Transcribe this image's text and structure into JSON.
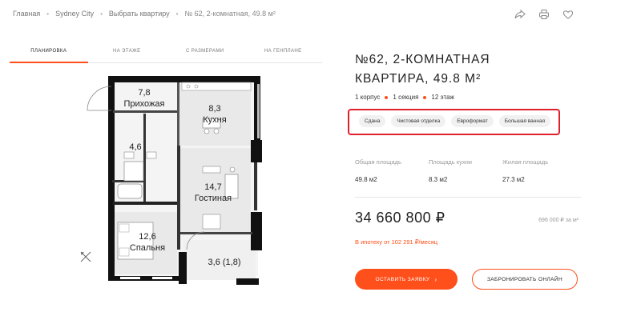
{
  "breadcrumb": {
    "items": [
      "Главная",
      "Sydney City",
      "Выбрать квартиру",
      "№ 62, 2-комнатная, 49.8 м²"
    ]
  },
  "toolbar": {
    "icons": [
      "share-icon",
      "print-icon",
      "heart-icon"
    ]
  },
  "tabs": [
    {
      "label": "ПЛАНИРОВКА",
      "active": true
    },
    {
      "label": "НА ЭТАЖЕ",
      "active": false
    },
    {
      "label": "С РАЗМЕРАМИ",
      "active": false
    },
    {
      "label": "НА ГЕНПЛАНЕ",
      "active": false
    }
  ],
  "floorplan": {
    "rooms": [
      {
        "area": "7,8",
        "name": "Прихожая"
      },
      {
        "area": "8,3",
        "name": "Кухня"
      },
      {
        "area": "4,6",
        "name": ""
      },
      {
        "area": "14,7",
        "name": "Гостиная"
      },
      {
        "area": "12,6",
        "name": "Спальня"
      },
      {
        "area": "3,6 (1,8)",
        "name": ""
      }
    ]
  },
  "apartment": {
    "title_line1": "№62, 2-КОМНАТНАЯ",
    "title_line2": "КВАРТИРА, 49.8 М²",
    "meta": [
      "1 корпус",
      "1 секция",
      "12 этаж"
    ],
    "tags": [
      "Сдана",
      "Чистовая отделка",
      "Евроформат",
      "Большая ванная"
    ]
  },
  "stats": [
    {
      "label": "Общая площадь",
      "value": "49.8 м2"
    },
    {
      "label": "Площадь кухни",
      "value": "8.3 м2"
    },
    {
      "label": "Жилая площадь",
      "value": "27.3 м2"
    }
  ],
  "pricing": {
    "price": "34 660 800 ₽",
    "per_m2": "696 000 ₽ за м²",
    "mortgage": "В ипотеку от 102 291 ₽/месяц"
  },
  "buttons": {
    "primary": "ОСТАВИТЬ ЗАЯВКУ",
    "primary_arrow": "›",
    "secondary": "ЗАБРОНИРОВАТЬ ОНЛАЙН"
  },
  "colors": {
    "accent": "#ff4f1a",
    "highlight_border": "#e0212b",
    "tag_bg": "#f1f1f1"
  }
}
